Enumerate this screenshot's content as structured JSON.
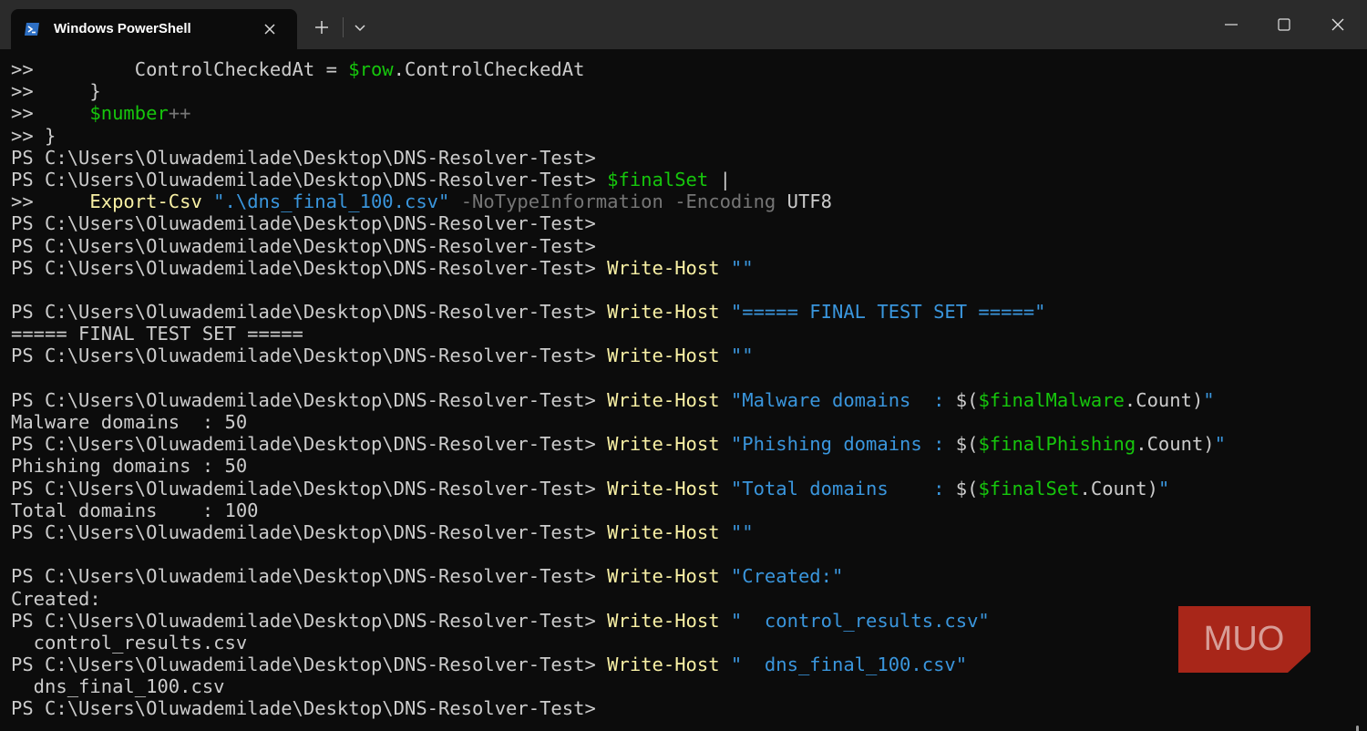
{
  "window": {
    "tab_title": "Windows PowerShell",
    "icons": {
      "tab": "powershell-icon",
      "close_tab": "close-icon",
      "new_tab": "plus-icon",
      "dropdown": "chevron-down-icon",
      "minimize": "minimize-icon",
      "maximize": "maximize-icon",
      "close_window": "close-icon"
    }
  },
  "colors": {
    "background": "#0c0c0c",
    "titlebar": "#2b2b2b",
    "text": "#cccccc",
    "variable": "#16c60c",
    "command": "#f9f1a5",
    "string": "#3a96dd",
    "parameter": "#767676",
    "watermark": "#c42b1c"
  },
  "watermark": {
    "text": "MUO"
  },
  "terminal": {
    "lines": [
      [
        {
          "t": ">>         ControlCheckedAt = ",
          "c": "t"
        },
        {
          "t": "$row",
          "c": "v"
        },
        {
          "t": ".ControlCheckedAt",
          "c": "t"
        }
      ],
      [
        {
          "t": ">>     }",
          "c": "t"
        }
      ],
      [
        {
          "t": ">>     ",
          "c": "t"
        },
        {
          "t": "$number",
          "c": "v"
        },
        {
          "t": "++",
          "c": "p"
        }
      ],
      [
        {
          "t": ">> }",
          "c": "t"
        }
      ],
      [
        {
          "t": "PS C:\\Users\\Oluwademilade\\Desktop\\DNS-Resolver-Test>",
          "c": "t"
        }
      ],
      [
        {
          "t": "PS C:\\Users\\Oluwademilade\\Desktop\\DNS-Resolver-Test> ",
          "c": "t"
        },
        {
          "t": "$finalSet",
          "c": "v"
        },
        {
          "t": " |",
          "c": "t"
        }
      ],
      [
        {
          "t": ">>     ",
          "c": "t"
        },
        {
          "t": "Export-Csv",
          "c": "c"
        },
        {
          "t": " ",
          "c": "t"
        },
        {
          "t": "\".\\dns_final_100.csv\"",
          "c": "s"
        },
        {
          "t": " -NoTypeInformation -Encoding",
          "c": "p"
        },
        {
          "t": " UTF8",
          "c": "t"
        }
      ],
      [
        {
          "t": "PS C:\\Users\\Oluwademilade\\Desktop\\DNS-Resolver-Test>",
          "c": "t"
        }
      ],
      [
        {
          "t": "PS C:\\Users\\Oluwademilade\\Desktop\\DNS-Resolver-Test>",
          "c": "t"
        }
      ],
      [
        {
          "t": "PS C:\\Users\\Oluwademilade\\Desktop\\DNS-Resolver-Test> ",
          "c": "t"
        },
        {
          "t": "Write-Host",
          "c": "c"
        },
        {
          "t": " ",
          "c": "t"
        },
        {
          "t": "\"\"",
          "c": "s"
        }
      ],
      [],
      [
        {
          "t": "PS C:\\Users\\Oluwademilade\\Desktop\\DNS-Resolver-Test> ",
          "c": "t"
        },
        {
          "t": "Write-Host",
          "c": "c"
        },
        {
          "t": " ",
          "c": "t"
        },
        {
          "t": "\"===== FINAL TEST SET =====\"",
          "c": "s"
        }
      ],
      [
        {
          "t": "===== FINAL TEST SET =====",
          "c": "t"
        }
      ],
      [
        {
          "t": "PS C:\\Users\\Oluwademilade\\Desktop\\DNS-Resolver-Test> ",
          "c": "t"
        },
        {
          "t": "Write-Host",
          "c": "c"
        },
        {
          "t": " ",
          "c": "t"
        },
        {
          "t": "\"\"",
          "c": "s"
        }
      ],
      [],
      [
        {
          "t": "PS C:\\Users\\Oluwademilade\\Desktop\\DNS-Resolver-Test> ",
          "c": "t"
        },
        {
          "t": "Write-Host",
          "c": "c"
        },
        {
          "t": " ",
          "c": "t"
        },
        {
          "t": "\"Malware domains  : ",
          "c": "s"
        },
        {
          "t": "$(",
          "c": "t"
        },
        {
          "t": "$finalMalware",
          "c": "v"
        },
        {
          "t": ".Count)",
          "c": "t"
        },
        {
          "t": "\"",
          "c": "s"
        }
      ],
      [
        {
          "t": "Malware domains  : 50",
          "c": "t"
        }
      ],
      [
        {
          "t": "PS C:\\Users\\Oluwademilade\\Desktop\\DNS-Resolver-Test> ",
          "c": "t"
        },
        {
          "t": "Write-Host",
          "c": "c"
        },
        {
          "t": " ",
          "c": "t"
        },
        {
          "t": "\"Phishing domains : ",
          "c": "s"
        },
        {
          "t": "$(",
          "c": "t"
        },
        {
          "t": "$finalPhishing",
          "c": "v"
        },
        {
          "t": ".Count)",
          "c": "t"
        },
        {
          "t": "\"",
          "c": "s"
        }
      ],
      [
        {
          "t": "Phishing domains : 50",
          "c": "t"
        }
      ],
      [
        {
          "t": "PS C:\\Users\\Oluwademilade\\Desktop\\DNS-Resolver-Test> ",
          "c": "t"
        },
        {
          "t": "Write-Host",
          "c": "c"
        },
        {
          "t": " ",
          "c": "t"
        },
        {
          "t": "\"Total domains    : ",
          "c": "s"
        },
        {
          "t": "$(",
          "c": "t"
        },
        {
          "t": "$finalSet",
          "c": "v"
        },
        {
          "t": ".Count)",
          "c": "t"
        },
        {
          "t": "\"",
          "c": "s"
        }
      ],
      [
        {
          "t": "Total domains    : 100",
          "c": "t"
        }
      ],
      [
        {
          "t": "PS C:\\Users\\Oluwademilade\\Desktop\\DNS-Resolver-Test> ",
          "c": "t"
        },
        {
          "t": "Write-Host",
          "c": "c"
        },
        {
          "t": " ",
          "c": "t"
        },
        {
          "t": "\"\"",
          "c": "s"
        }
      ],
      [],
      [
        {
          "t": "PS C:\\Users\\Oluwademilade\\Desktop\\DNS-Resolver-Test> ",
          "c": "t"
        },
        {
          "t": "Write-Host",
          "c": "c"
        },
        {
          "t": " ",
          "c": "t"
        },
        {
          "t": "\"Created:\"",
          "c": "s"
        }
      ],
      [
        {
          "t": "Created:",
          "c": "t"
        }
      ],
      [
        {
          "t": "PS C:\\Users\\Oluwademilade\\Desktop\\DNS-Resolver-Test> ",
          "c": "t"
        },
        {
          "t": "Write-Host",
          "c": "c"
        },
        {
          "t": " ",
          "c": "t"
        },
        {
          "t": "\"  control_results.csv\"",
          "c": "s"
        }
      ],
      [
        {
          "t": "  control_results.csv",
          "c": "t"
        }
      ],
      [
        {
          "t": "PS C:\\Users\\Oluwademilade\\Desktop\\DNS-Resolver-Test> ",
          "c": "t"
        },
        {
          "t": "Write-Host",
          "c": "c"
        },
        {
          "t": " ",
          "c": "t"
        },
        {
          "t": "\"  dns_final_100.csv\"",
          "c": "s"
        }
      ],
      [
        {
          "t": "  dns_final_100.csv",
          "c": "t"
        }
      ],
      [
        {
          "t": "PS C:\\Users\\Oluwademilade\\Desktop\\DNS-Resolver-Test>",
          "c": "t"
        }
      ]
    ]
  }
}
